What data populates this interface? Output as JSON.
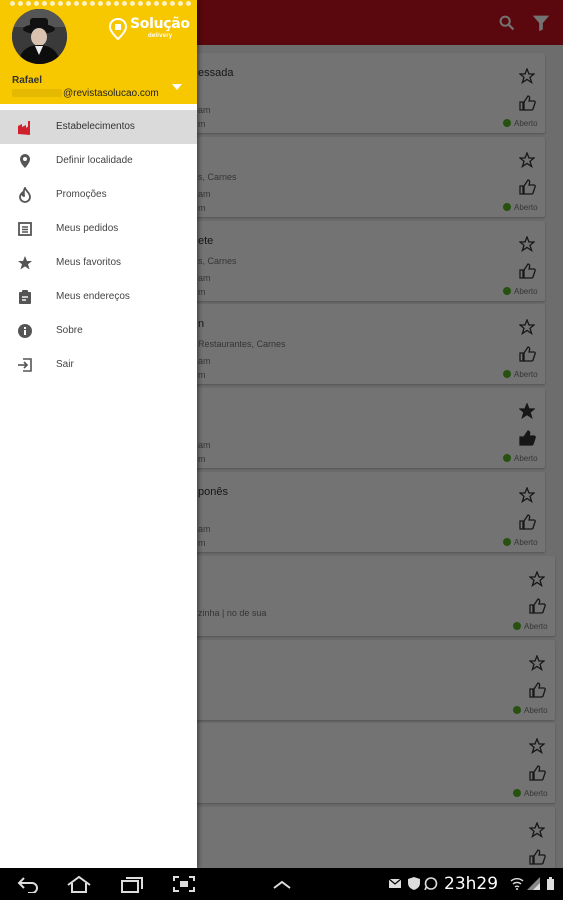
{
  "background_app": {
    "colors": {
      "appbar": "#c8101e",
      "open_dot": "#58b322"
    },
    "actions": [
      "search-icon",
      "filter-icon"
    ],
    "cards": [
      {
        "title": "essada",
        "subtitle": "",
        "line1": "am",
        "line2": "m",
        "favorite": false,
        "status": "Aberto"
      },
      {
        "title": "",
        "subtitle": "s, Carnes",
        "line1": "am",
        "line2": "m",
        "favorite": false,
        "status": "Aberto"
      },
      {
        "title": "ete",
        "subtitle": "s, Carnes",
        "line1": "am",
        "line2": "m",
        "favorite": false,
        "status": "Aberto"
      },
      {
        "title": "n",
        "subtitle": "Restaurantes, Carnes",
        "line1": "am",
        "line2": "m",
        "favorite": false,
        "status": "Aberto"
      },
      {
        "title": "",
        "subtitle": "",
        "line1": "am",
        "line2": "m",
        "favorite": true,
        "status": "Aberto"
      },
      {
        "title": "ponês",
        "subtitle": "",
        "line1": "am",
        "line2": "m",
        "favorite": false,
        "status": "Aberto"
      },
      {
        "title": "",
        "subtitle": "",
        "line1": "zinha | no de sua",
        "line2": "",
        "favorite": false,
        "status": "Aberto"
      },
      {
        "title": "",
        "subtitle": "",
        "line1": "",
        "line2": "",
        "favorite": false,
        "status": "Aberto"
      },
      {
        "title": "",
        "subtitle": "",
        "line1": "",
        "line2": "",
        "favorite": false,
        "status": "Aberto"
      },
      {
        "title": "",
        "subtitle": "",
        "line1": "",
        "line2": "",
        "favorite": false,
        "status": ""
      }
    ]
  },
  "drawer": {
    "colors": {
      "header_bg": "#f7c800",
      "active_bg": "#dadada",
      "active_icon": "#d0202e",
      "icon": "#555555"
    },
    "logo": {
      "name": "Solução",
      "tagline": "delivery"
    },
    "user": {
      "name": "Rafael",
      "email_visible": "@revistasolucao.com"
    },
    "menu": [
      {
        "label": "Estabelecimentos",
        "icon": "store-icon",
        "active": true
      },
      {
        "label": "Definir localidade",
        "icon": "location-pin-icon",
        "active": false
      },
      {
        "label": "Promoções",
        "icon": "flame-icon",
        "active": false
      },
      {
        "label": "Meus pedidos",
        "icon": "list-icon",
        "active": false
      },
      {
        "label": "Meus favoritos",
        "icon": "star-icon",
        "active": false
      },
      {
        "label": "Meus endereços",
        "icon": "clipboard-icon",
        "active": false
      },
      {
        "label": "Sobre",
        "icon": "info-icon",
        "active": false
      },
      {
        "label": "Sair",
        "icon": "exit-icon",
        "active": false
      }
    ]
  },
  "system_bar": {
    "clock": "23h29",
    "nav": [
      "back-icon",
      "home-icon",
      "recents-icon",
      "screenshot-icon",
      "expand-up-icon"
    ],
    "status_icons": [
      "message-icon",
      "shield-icon",
      "whatsapp-icon",
      "wifi-icon",
      "signal-icon",
      "battery-icon"
    ]
  }
}
